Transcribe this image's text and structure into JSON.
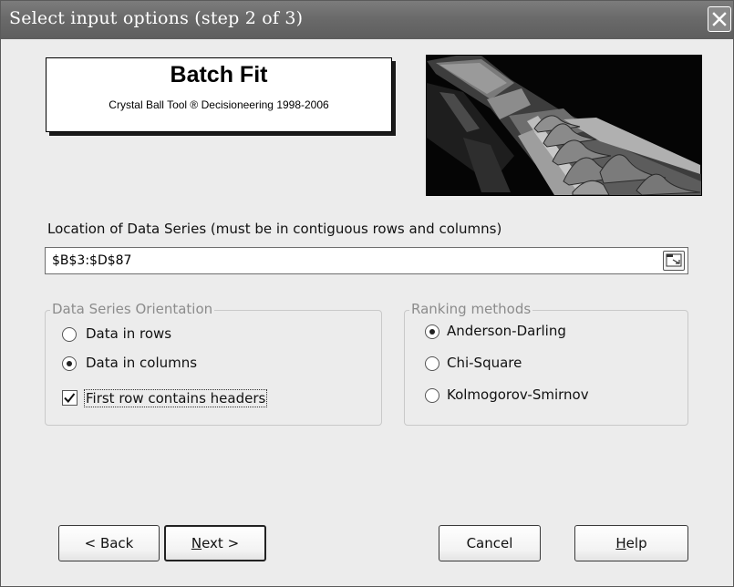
{
  "dialog": {
    "title": "Select input options (step 2 of 3)"
  },
  "banner": {
    "title": "Batch Fit",
    "subtitle": "Crystal Ball Tool ® Decisioneering 1998-2006"
  },
  "location": {
    "label": "Location of Data Series (must be in contiguous rows and columns)",
    "value": "$B$3:$D$87"
  },
  "orientation": {
    "title": "Data Series Orientation",
    "options": [
      "Data in rows",
      "Data in columns"
    ],
    "selected": "Data in columns",
    "header_checkbox_label": "First row contains headers",
    "header_checkbox_checked": true
  },
  "ranking": {
    "title": "Ranking methods",
    "options": [
      "Anderson-Darling",
      "Chi-Square",
      "Kolmogorov-Smirnov"
    ],
    "selected": "Anderson-Darling"
  },
  "buttons": {
    "back": "< Back",
    "next_mnemonic": "N",
    "next_rest": "ext >",
    "cancel": "Cancel",
    "help_mnemonic": "H",
    "help_rest": "elp"
  }
}
